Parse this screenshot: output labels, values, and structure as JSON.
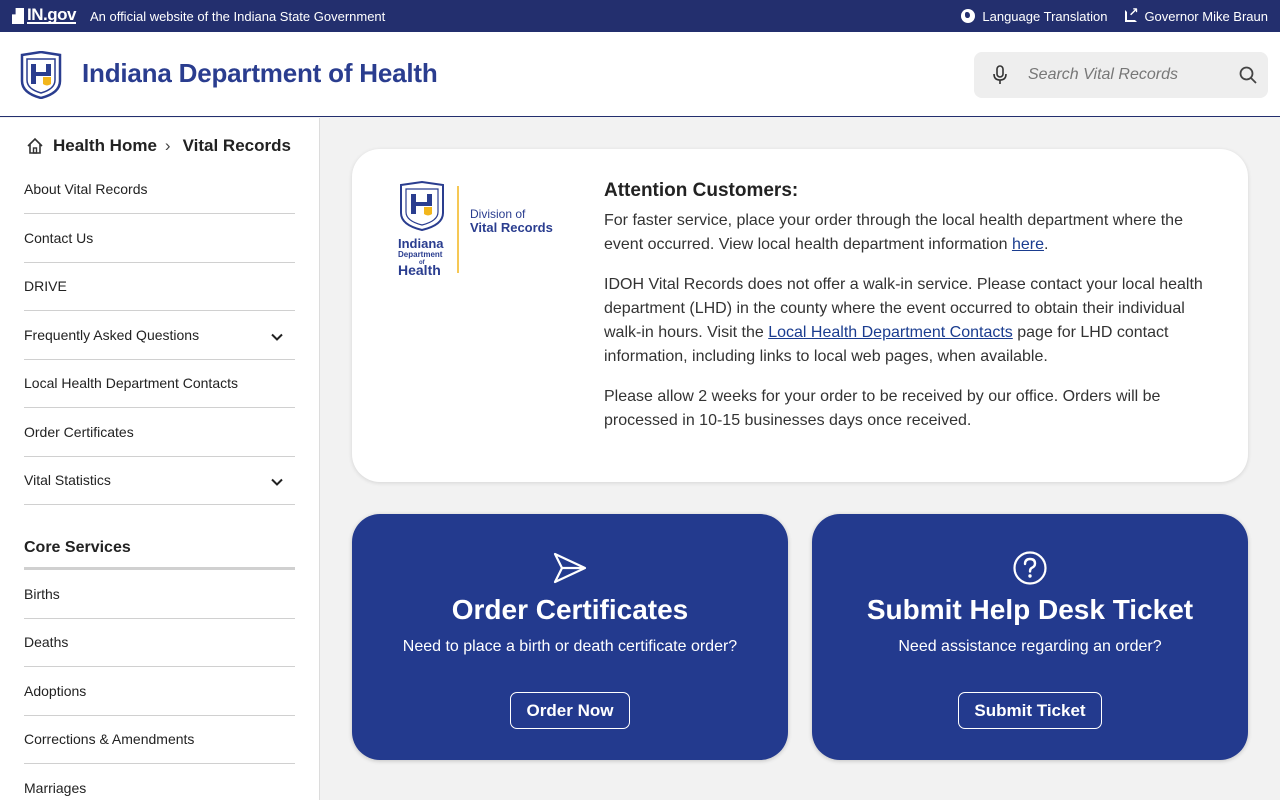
{
  "topbar": {
    "ingov": "IN.gov",
    "official": "An official website of the Indiana State Government",
    "language": "Language Translation",
    "governor": "Governor Mike Braun",
    "icons": [
      "globe-icon",
      "external-link-icon"
    ]
  },
  "header": {
    "title": "Indiana Department of Health",
    "search_placeholder": "Search Vital Records",
    "icons": [
      "microphone-icon",
      "search-icon"
    ]
  },
  "breadcrumb": {
    "home": "Health Home",
    "current": "Vital Records"
  },
  "sidebar": {
    "items": [
      {
        "label": "About Vital Records",
        "expandable": false
      },
      {
        "label": "Contact Us",
        "expandable": false
      },
      {
        "label": "DRIVE",
        "expandable": false
      },
      {
        "label": "Frequently Asked Questions",
        "expandable": true
      },
      {
        "label": "Local Health Department Contacts",
        "expandable": false
      },
      {
        "label": "Order Certificates",
        "expandable": false
      },
      {
        "label": "Vital Statistics",
        "expandable": true
      }
    ],
    "core_title": "Core Services",
    "core_items": [
      "Births",
      "Deaths",
      "Adoptions",
      "Corrections & Amendments",
      "Marriages"
    ]
  },
  "notice": {
    "logo": {
      "dept_line1": "Indiana",
      "dept_line2": "Department",
      "dept_line3": "of",
      "dept_line4": "Health",
      "division": "Division of",
      "division_name": "Vital Records"
    },
    "title": "Attention Customers:",
    "p1_a": "For faster service, place your order through the local health department where the event occurred. View local health department information ",
    "p1_link": "here",
    "p1_b": ".",
    "p2_a": "IDOH Vital Records does not offer a walk-in service. Please contact your local health department (LHD) in the county where the event occurred to obtain their individual walk-in hours. Visit the ",
    "p2_link": "Local Health Department Contacts",
    "p2_b": " page for LHD contact information, including links to local web pages, when available.",
    "p3": "Please allow 2 weeks for your order to be received by our office.  Orders will be processed in 10-15 businesses days once received."
  },
  "cards": [
    {
      "title": "Order Certificates",
      "subtitle": "Need to place a birth or death certificate order?",
      "button": "Order Now",
      "icon": "paper-plane-icon"
    },
    {
      "title": "Submit Help Desk Ticket",
      "subtitle": "Need assistance regarding an order?",
      "button": "Submit Ticket",
      "icon": "question-circle-icon"
    }
  ],
  "colors": {
    "navy": "#232f6e",
    "brand_blue": "#2a3d8f",
    "card_blue": "#233a8e",
    "gold": "#f2b61c"
  }
}
